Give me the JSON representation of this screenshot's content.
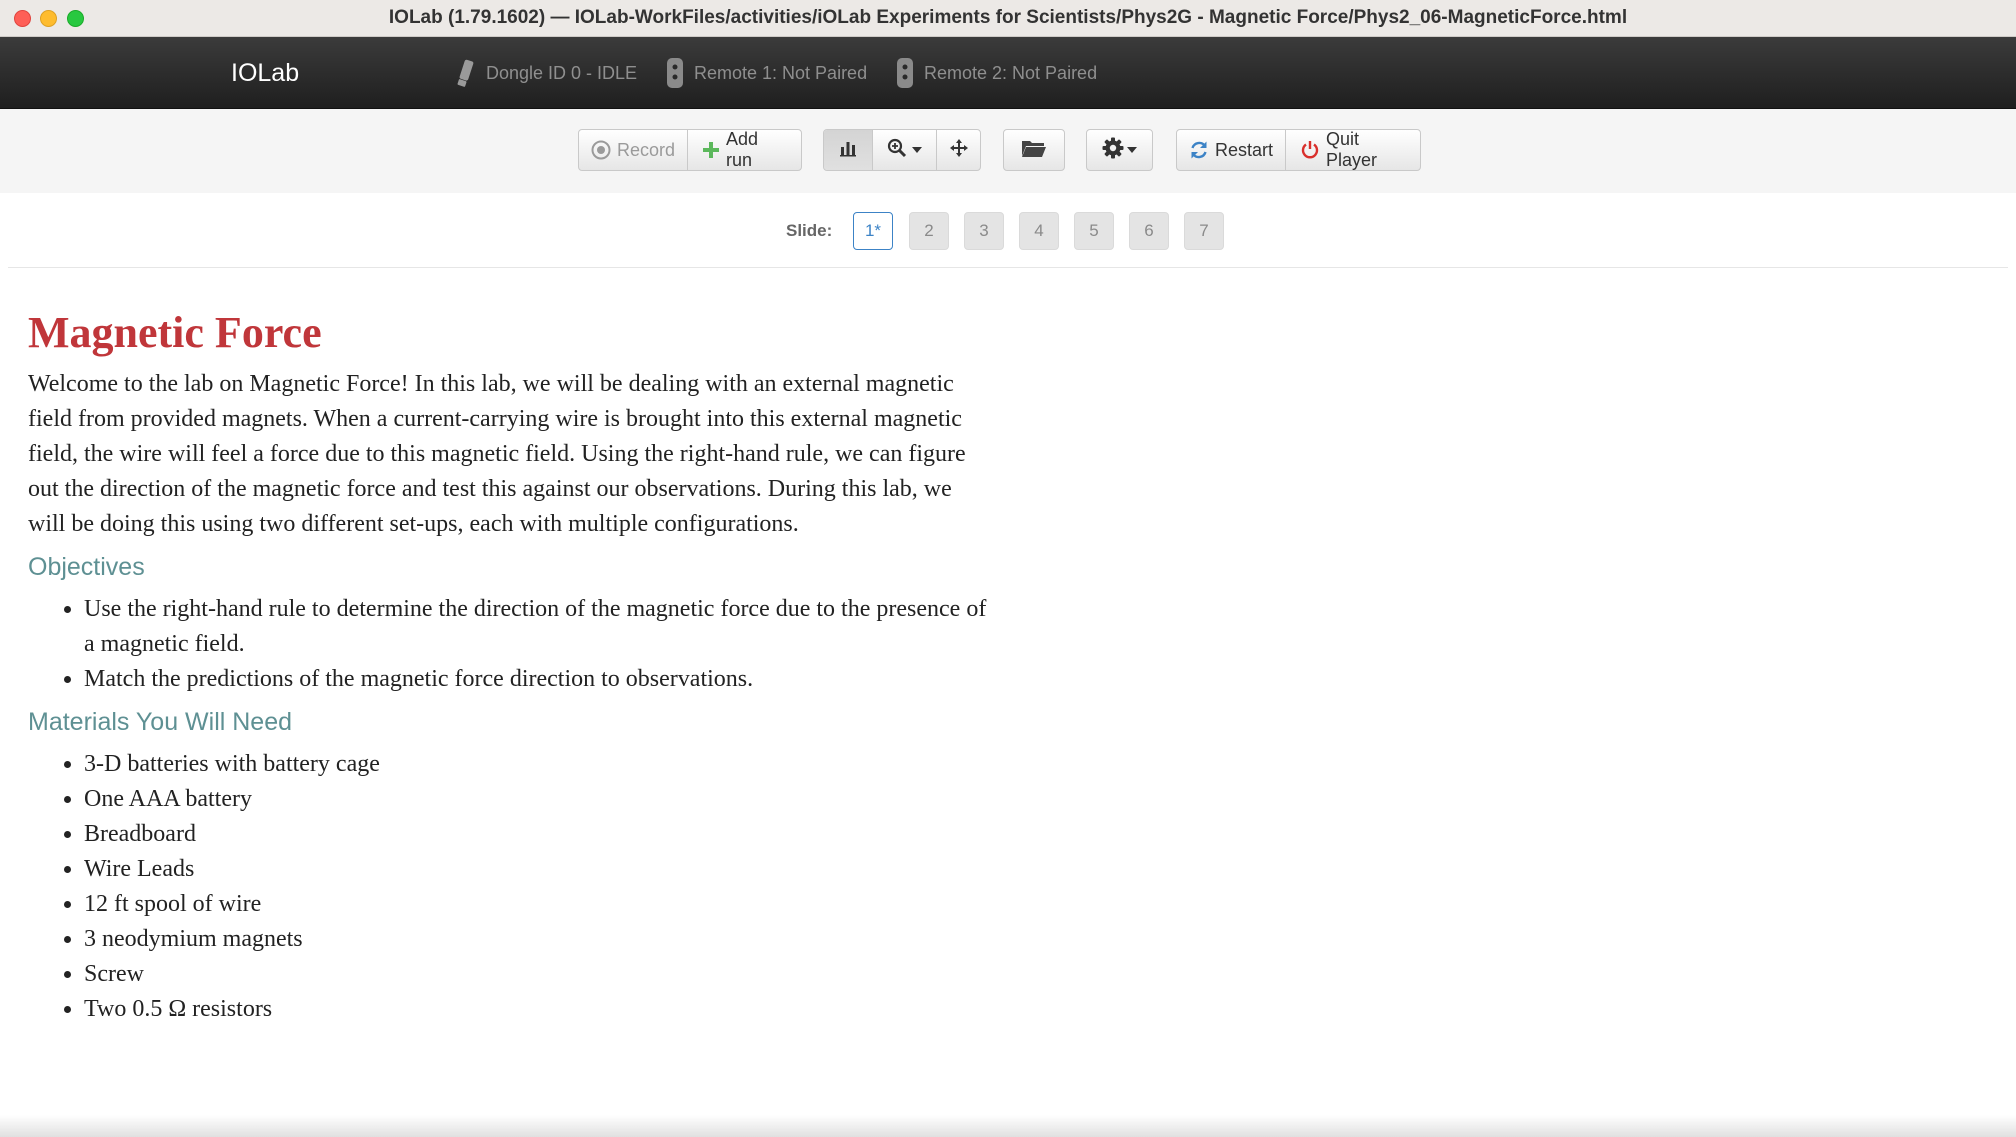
{
  "window": {
    "title": "IOLab (1.79.1602) — IOLab-WorkFiles/activities/iOLab Experiments for Scientists/Phys2G - Magnetic Force/Phys2_06-MagneticForce.html"
  },
  "navbar": {
    "brand": "IOLab",
    "dongle": "Dongle ID 0 - IDLE",
    "remote1": "Remote 1: Not Paired",
    "remote2": "Remote 2: Not Paired"
  },
  "toolbar": {
    "record_label": "Record",
    "add_run_label": "Add run",
    "restart_label": "Restart",
    "quit_label": "Quit Player"
  },
  "slides": {
    "label": "Slide:",
    "items": [
      "1*",
      "2",
      "3",
      "4",
      "5",
      "6",
      "7"
    ]
  },
  "content": {
    "title": "Magnetic Force",
    "intro": "Welcome to the lab on Magnetic Force! In this lab, we will be dealing with an external magnetic field from provided magnets. When a current-carrying wire is brought into this external magnetic field, the wire will feel a force due to this magnetic field. Using the right-hand rule, we can figure out the direction of the magnetic force and test this against our observations. During this lab, we will be doing this using two different set-ups, each with multiple configurations.",
    "objectives_heading": "Objectives",
    "objectives": [
      "Use the right-hand rule to determine the direction of the magnetic force due to the presence of a magnetic field.",
      "Match the predictions of the magnetic force direction to observations."
    ],
    "materials_heading": "Materials You Will Need",
    "materials": [
      "3-D batteries with battery cage",
      "One AAA battery",
      "Breadboard",
      "Wire Leads",
      "12 ft spool of wire",
      "3 neodymium magnets",
      "Screw",
      "Two 0.5 Ω resistors"
    ]
  },
  "colors": {
    "title_red": "#c0363a",
    "heading_teal": "#5e9093",
    "accent_blue": "#3c83c6",
    "quit_red": "#d9302c",
    "add_green": "#5cb85c"
  }
}
